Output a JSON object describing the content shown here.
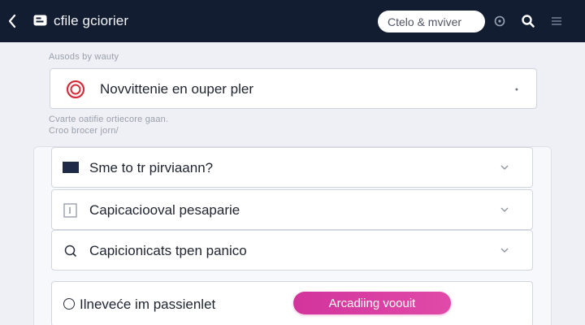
{
  "header": {
    "title": "cfile gciorier",
    "search_placeholder": "Ctelo & mviver"
  },
  "helpers": {
    "top": "Ausods by wauty",
    "middle_1": "Cvarte oatifie ortiecore gaan.",
    "middle_2": "Croo brocer jorn/"
  },
  "primary_select": {
    "label": "Novvittenie en ouper pler"
  },
  "options": [
    {
      "label": "Sme to tr pirviaann?",
      "icon": "flag-icon"
    },
    {
      "label": "Capicaciooval pesaparie",
      "icon": "document-icon"
    },
    {
      "label": "Capicionicats tpen panico",
      "icon": "search-icon"
    }
  ],
  "bottom": {
    "label": "Ilneveće im passienlet",
    "button_label": "Arcadiing voouit"
  },
  "colors": {
    "topbar": "#131d31",
    "accent": "#d6399e",
    "record": "#d62d3a",
    "background": "#eef0f5"
  }
}
